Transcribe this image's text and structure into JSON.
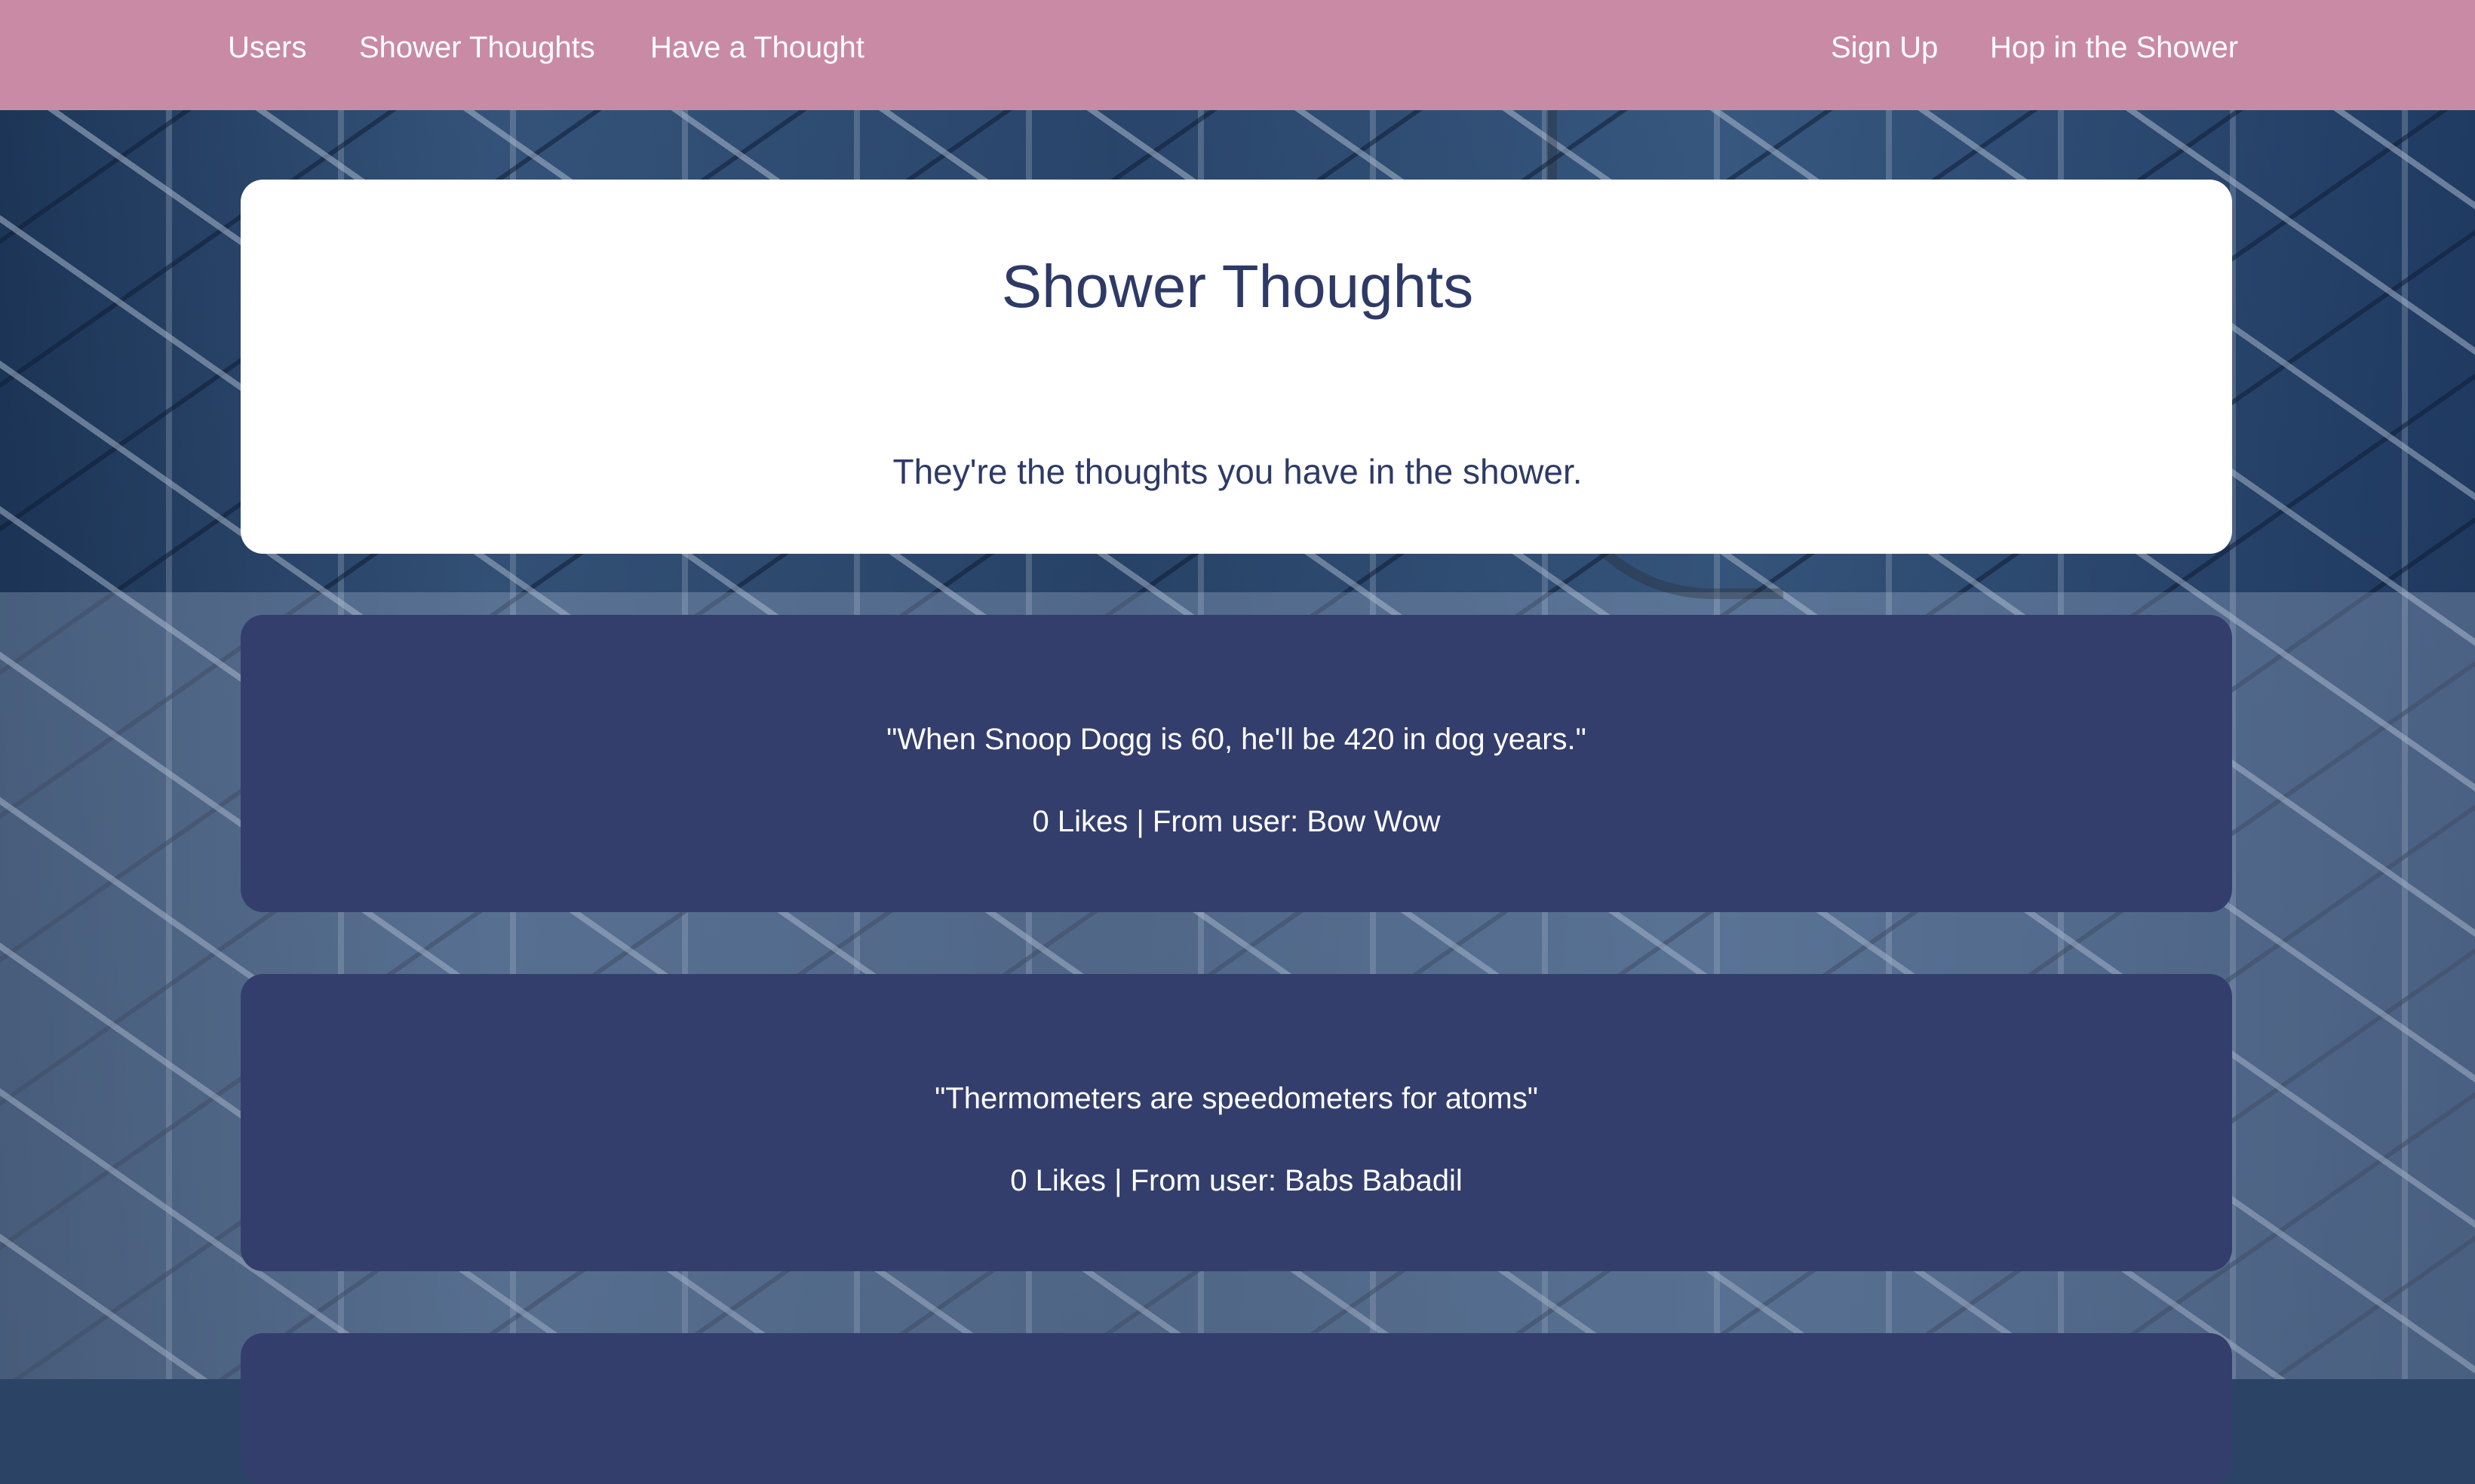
{
  "nav": {
    "left": [
      {
        "label": "Users"
      },
      {
        "label": "Shower Thoughts"
      },
      {
        "label": "Have a Thought"
      }
    ],
    "right": [
      {
        "label": "Sign Up"
      },
      {
        "label": "Hop in the Shower"
      }
    ],
    "bar_color": "#c98aa6"
  },
  "hero": {
    "title": "Shower Thoughts",
    "subtitle": "They're the thoughts you have in the shower."
  },
  "thoughts": [
    {
      "quote": "\"When Snoop Dogg is 60, he'll be 420 in dog years.\"",
      "meta": "0 Likes | From user: Bow Wow"
    },
    {
      "quote": "\"Thermometers are speedometers for atoms\"",
      "meta": "0 Likes | From user: Babs Babadil"
    }
  ],
  "colors": {
    "card_dark": "#343e6c",
    "text_dark": "#2e3a66"
  }
}
